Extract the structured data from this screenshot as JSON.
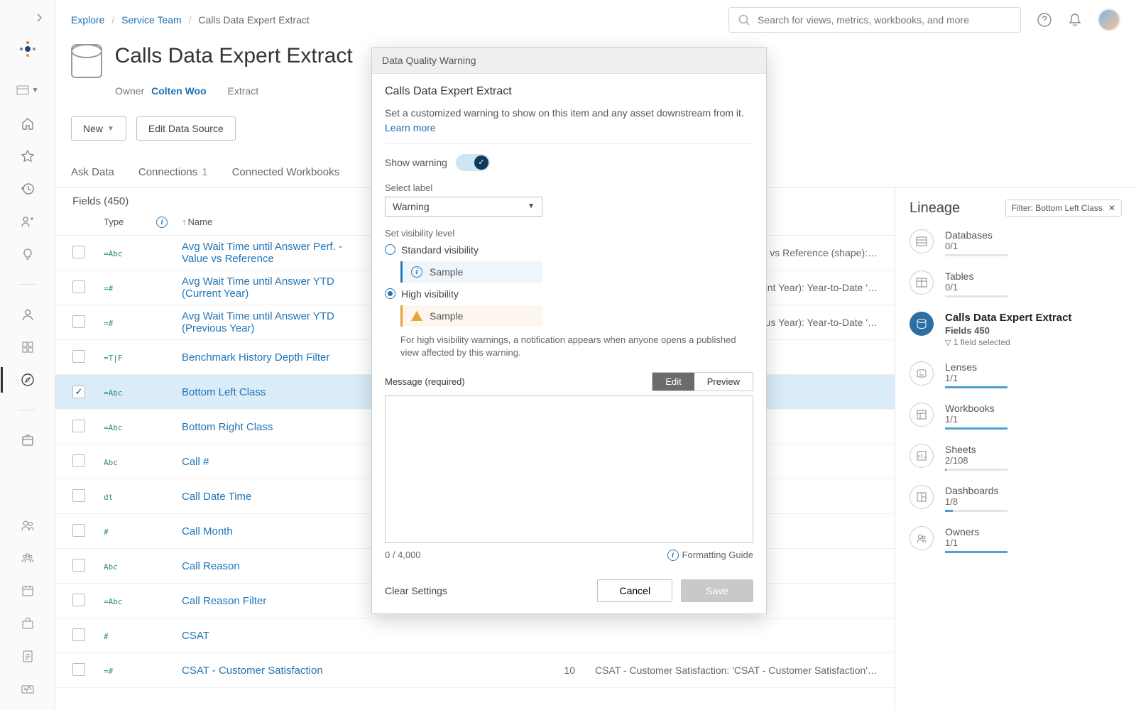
{
  "breadcrumbs": {
    "explore": "Explore",
    "team": "Service Team",
    "current": "Calls Data Expert Extract"
  },
  "search": {
    "placeholder": "Search for views, metrics, workbooks, and more"
  },
  "header": {
    "title": "Calls Data Expert Extract",
    "owner_label": "Owner",
    "owner_name": "Colten Woo",
    "extract": "Extract",
    "new_btn": "New",
    "edit_btn": "Edit Data Source"
  },
  "tabs": {
    "ask": "Ask Data",
    "conn": "Connections",
    "conn_count": "1",
    "workbooks": "Connected Workbooks"
  },
  "fields": {
    "heading": "Fields (450)",
    "col_type": "Type",
    "col_name": "Name",
    "rows": [
      {
        "type": "=Abc",
        "name": "Avg Wait Time until Answer Perf. - Value vs Reference",
        "tail": "e vs Reference (shape):…"
      },
      {
        "type": "=#",
        "name": "Avg Wait Time until Answer YTD (Current Year)",
        "tail": "nt Year): Year-to-Date '…"
      },
      {
        "type": "=#",
        "name": "Avg Wait Time until Answer YTD (Previous Year)",
        "tail": "us Year): Year-to-Date '…"
      },
      {
        "type": "=T|F",
        "name": "Benchmark History Depth Filter",
        "tail": ""
      },
      {
        "type": "=Abc",
        "name": "Bottom Left Class",
        "tail": "",
        "selected": true
      },
      {
        "type": "=Abc",
        "name": "Bottom Right Class",
        "tail": ""
      },
      {
        "type": "Abc",
        "name": "Call #",
        "tail": ""
      },
      {
        "type": "dt",
        "name": "Call Date Time",
        "tail": ""
      },
      {
        "type": "#",
        "name": "Call Month",
        "tail": ""
      },
      {
        "type": "Abc",
        "name": "Call Reason",
        "tail": ""
      },
      {
        "type": "=Abc",
        "name": "Call Reason Filter",
        "tail": ""
      },
      {
        "type": "#",
        "name": "CSAT",
        "tail": ""
      },
      {
        "type": "=#",
        "name": "CSAT - Customer Satisfaction",
        "tail_num": "10",
        "tail": "CSAT - Customer Satisfaction: 'CSAT - Customer Satisfaction'…"
      }
    ]
  },
  "lineage": {
    "title": "Lineage",
    "filter": "Filter: Bottom Left Class",
    "items": [
      {
        "icon": "db",
        "label": "Databases",
        "value": "0/1",
        "fill": 0
      },
      {
        "icon": "tbl",
        "label": "Tables",
        "value": "0/1",
        "fill": 0
      },
      {
        "icon": "ds",
        "label": "Calls Data Expert Extract",
        "fields": "Fields 450",
        "selected": "1 field selected",
        "active": true
      },
      {
        "icon": "lens",
        "label": "Lenses",
        "value": "1/1",
        "fill": 100
      },
      {
        "icon": "wb",
        "label": "Workbooks",
        "value": "1/1",
        "fill": 100
      },
      {
        "icon": "sheet",
        "label": "Sheets",
        "value": "2/108",
        "fill": 2
      },
      {
        "icon": "dash",
        "label": "Dashboards",
        "value": "1/8",
        "fill": 13
      },
      {
        "icon": "owner",
        "label": "Owners",
        "value": "1/1",
        "fill": 100
      }
    ]
  },
  "modal": {
    "title": "Data Quality Warning",
    "subject": "Calls Data Expert Extract",
    "desc": "Set a customized warning to show on this item and any asset downstream from it.",
    "learn": "Learn more",
    "show_warning": "Show warning",
    "select_label_lbl": "Select label",
    "select_label_val": "Warning",
    "visibility_lbl": "Set visibility level",
    "std": "Standard visibility",
    "high": "High visibility",
    "sample": "Sample",
    "high_note": "For high visibility warnings, a notification appears when anyone opens a published view affected by this warning.",
    "msg_label": "Message (required)",
    "edit": "Edit",
    "preview": "Preview",
    "counter": "0 / 4,000",
    "guide": "Formatting Guide",
    "clear": "Clear Settings",
    "cancel": "Cancel",
    "save": "Save"
  }
}
